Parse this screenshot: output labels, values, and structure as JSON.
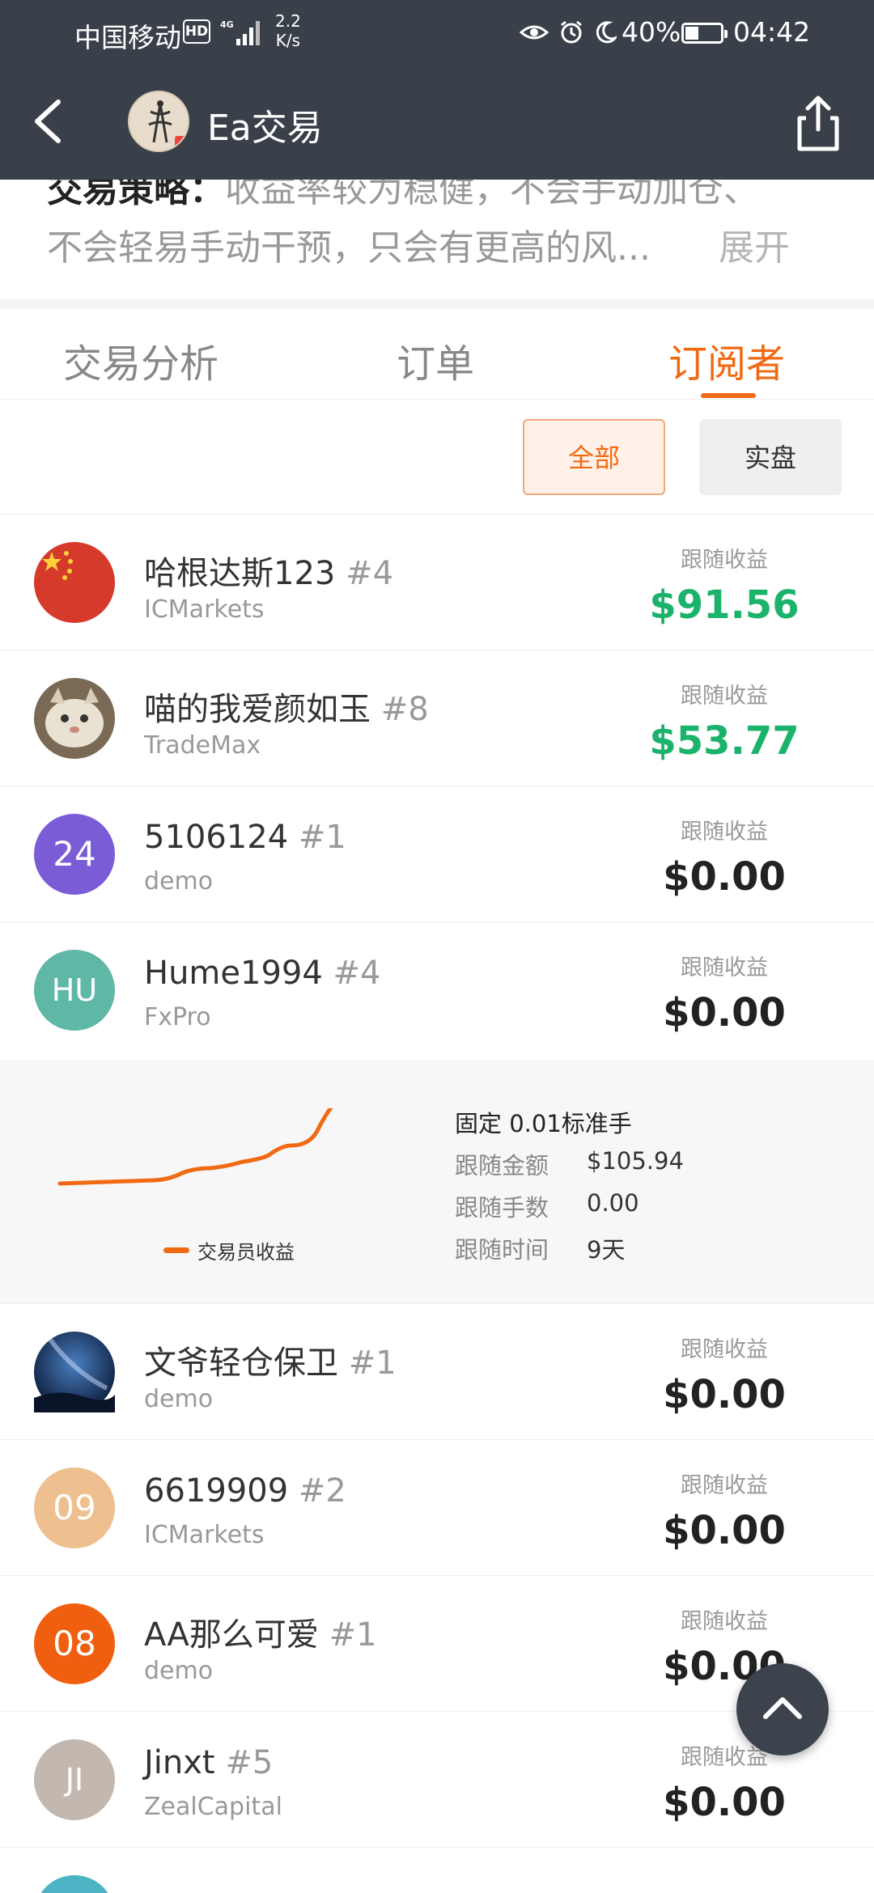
{
  "status": {
    "carrier": "中国移动",
    "hd": "HD",
    "speed_value": "2.2",
    "speed_unit": "K/s",
    "battery": "40%",
    "time": "04:42"
  },
  "header": {
    "title": "Ea交易"
  },
  "description": {
    "line1_label": "交易策略：",
    "line1_text": "收益率较为稳健，不会手动加仓、",
    "line2": "不会轻易手动干预，只会有更高的风...",
    "expand": "展开"
  },
  "tabs": [
    "交易分析",
    "订单",
    "订阅者"
  ],
  "filters": {
    "all": "全部",
    "live": "实盘"
  },
  "profit_label": "跟随收益",
  "subscribers": [
    {
      "name": "哈根达斯123",
      "rank": "#4",
      "broker": "ICMarkets",
      "profit": "$91.56",
      "avatar_text": "",
      "avatar_color": "#d63a2a",
      "positive": true
    },
    {
      "name": "喵的我爱颜如玉",
      "rank": "#8",
      "broker": "TradeMax",
      "profit": "$53.77",
      "avatar_text": "",
      "avatar_color": "#8a7a66",
      "positive": true
    },
    {
      "name": "5106124",
      "rank": "#1",
      "broker": "demo",
      "profit": "$0.00",
      "avatar_text": "24",
      "avatar_color": "#7a5cd6",
      "positive": false
    },
    {
      "name": "Hume1994",
      "rank": "#4",
      "broker": "FxPro",
      "profit": "$0.00",
      "avatar_text": "HU",
      "avatar_color": "#5fb7a5",
      "positive": false
    },
    {
      "name": "文爷轻仓保卫",
      "rank": "#1",
      "broker": "demo",
      "profit": "$0.00",
      "avatar_text": "",
      "avatar_color": "#1d3a6b",
      "positive": false
    },
    {
      "name": "6619909",
      "rank": "#2",
      "broker": "ICMarkets",
      "profit": "$0.00",
      "avatar_text": "09",
      "avatar_color": "#efc08f",
      "positive": false
    },
    {
      "name": "AA那么可爱",
      "rank": "#1",
      "broker": "demo",
      "profit": "$0.00",
      "avatar_text": "08",
      "avatar_color": "#f05f0f",
      "positive": false
    },
    {
      "name": "Jinxt",
      "rank": "#5",
      "broker": "ZealCapital",
      "profit": "$0.00",
      "avatar_text": "JI",
      "avatar_color": "#c2b8b0",
      "positive": false
    }
  ],
  "detail": {
    "mode": "固定 0.01标准手",
    "amount_label": "跟随金额",
    "amount": "$105.94",
    "lots_label": "跟随手数",
    "lots": "0.00",
    "time_label": "跟随时间",
    "time": "9天",
    "legend": "交易员收益"
  },
  "colors": {
    "accent": "#f06a14",
    "positive": "#1bb36b",
    "header_bg": "#3a4049"
  },
  "icons": [
    "back-arrow-icon",
    "share-icon",
    "scroll-top-icon",
    "eye-icon",
    "alarm-icon",
    "moon-icon",
    "battery-icon",
    "signal-icon"
  ]
}
